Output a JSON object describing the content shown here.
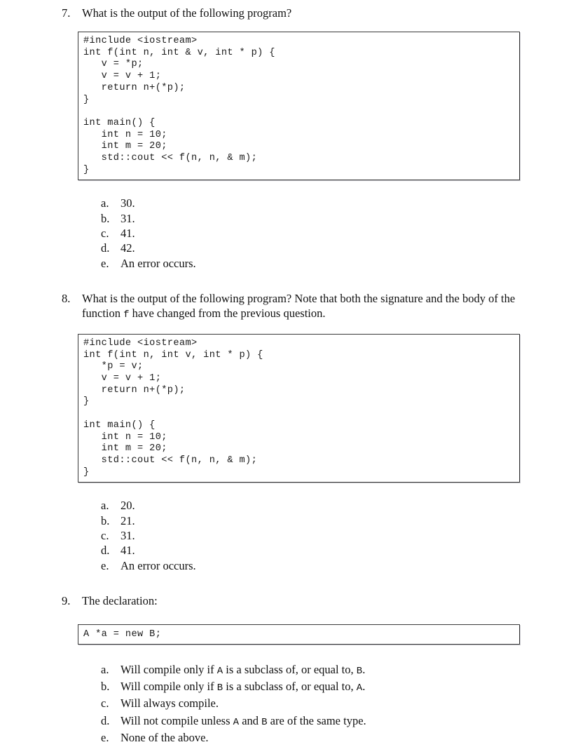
{
  "document": {
    "type": "exam-questions",
    "questions": [
      {
        "number": "7.",
        "text": "What is the output of the following program?",
        "code": "#include <iostream>\nint f(int n, int & v, int * p) {\n   v = *p;\n   v = v + 1;\n   return n+(*p);\n}\n\nint main() {\n   int n = 10;\n   int m = 20;\n   std::cout << f(n, n, & m);\n}",
        "options": [
          {
            "marker": "a.",
            "text": "30."
          },
          {
            "marker": "b.",
            "text": "31."
          },
          {
            "marker": "c.",
            "text": "41."
          },
          {
            "marker": "d.",
            "text": "42."
          },
          {
            "marker": "e.",
            "text": "An error occurs."
          }
        ]
      },
      {
        "number": "8.",
        "text_part1": "What is the output of the following program?  Note that both the signature and the body of the function ",
        "text_mono": "f",
        "text_part2": " have changed from the previous question.",
        "code": "#include <iostream>\nint f(int n, int v, int * p) {\n   *p = v;\n   v = v + 1;\n   return n+(*p);\n}\n\nint main() {\n   int n = 10;\n   int m = 20;\n   std::cout << f(n, n, & m);\n}",
        "options": [
          {
            "marker": "a.",
            "text": "20."
          },
          {
            "marker": "b.",
            "text": "21."
          },
          {
            "marker": "c.",
            "text": "31."
          },
          {
            "marker": "d.",
            "text": "41."
          },
          {
            "marker": "e.",
            "text": "An error occurs."
          }
        ]
      },
      {
        "number": "9.",
        "text": "The declaration:",
        "code": "A *a = new B;",
        "options": [
          {
            "marker": "a.",
            "part1": "Will compile only if ",
            "mono1": "A",
            "part2": " is a subclass of, or equal to, ",
            "mono2": "B",
            "part3": "."
          },
          {
            "marker": "b.",
            "part1": "Will compile only if ",
            "mono1": "B",
            "part2": " is a subclass of, or equal to, ",
            "mono2": "A",
            "part3": "."
          },
          {
            "marker": "c.",
            "part1": "Will always compile.",
            "mono1": "",
            "part2": "",
            "mono2": "",
            "part3": ""
          },
          {
            "marker": "d.",
            "part1": "Will not compile unless ",
            "mono1": "A",
            "part2": " and ",
            "mono2": "B",
            "part3": " are of the same type."
          },
          {
            "marker": "e.",
            "part1": "None of the above.",
            "mono1": "",
            "part2": "",
            "mono2": "",
            "part3": ""
          }
        ]
      }
    ]
  }
}
